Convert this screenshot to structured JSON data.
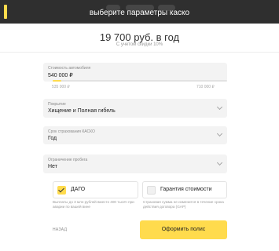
{
  "header": {
    "title": "выберите параметры каско"
  },
  "summary": {
    "price": "19 700 руб. в год",
    "discount": "С учетом скидки 10%"
  },
  "car_cost": {
    "label": "Стоимость автомобиля",
    "value": "540 000 ₽",
    "min": "535 000 ₽",
    "max": "710 000 ₽",
    "slider_fraction": 0.03
  },
  "risks": {
    "label": "Покрытие",
    "value": "Хищение и Полная гибель"
  },
  "term": {
    "label": "Срок страхования КАСКО",
    "value": "Год"
  },
  "mileage": {
    "label": "Ограничение пробега",
    "value": "Нет"
  },
  "options": {
    "dago": {
      "label": "ДАГО",
      "checked": true,
      "note": "Выплаты до 3 млн рублей вместо 400 тысяч при аварии по вашей вине"
    },
    "guarantee": {
      "label": "Гарантия стоимости",
      "checked": false,
      "note": "Страховая сумма не изменится в течение срока действия договора (GAP)"
    }
  },
  "actions": {
    "back": "НАЗАД",
    "submit": "Оформить полис"
  },
  "colors": {
    "accent": "#ffdb4d",
    "header_bg": "#2f2f2f",
    "field_bg": "#f3f3f3"
  }
}
